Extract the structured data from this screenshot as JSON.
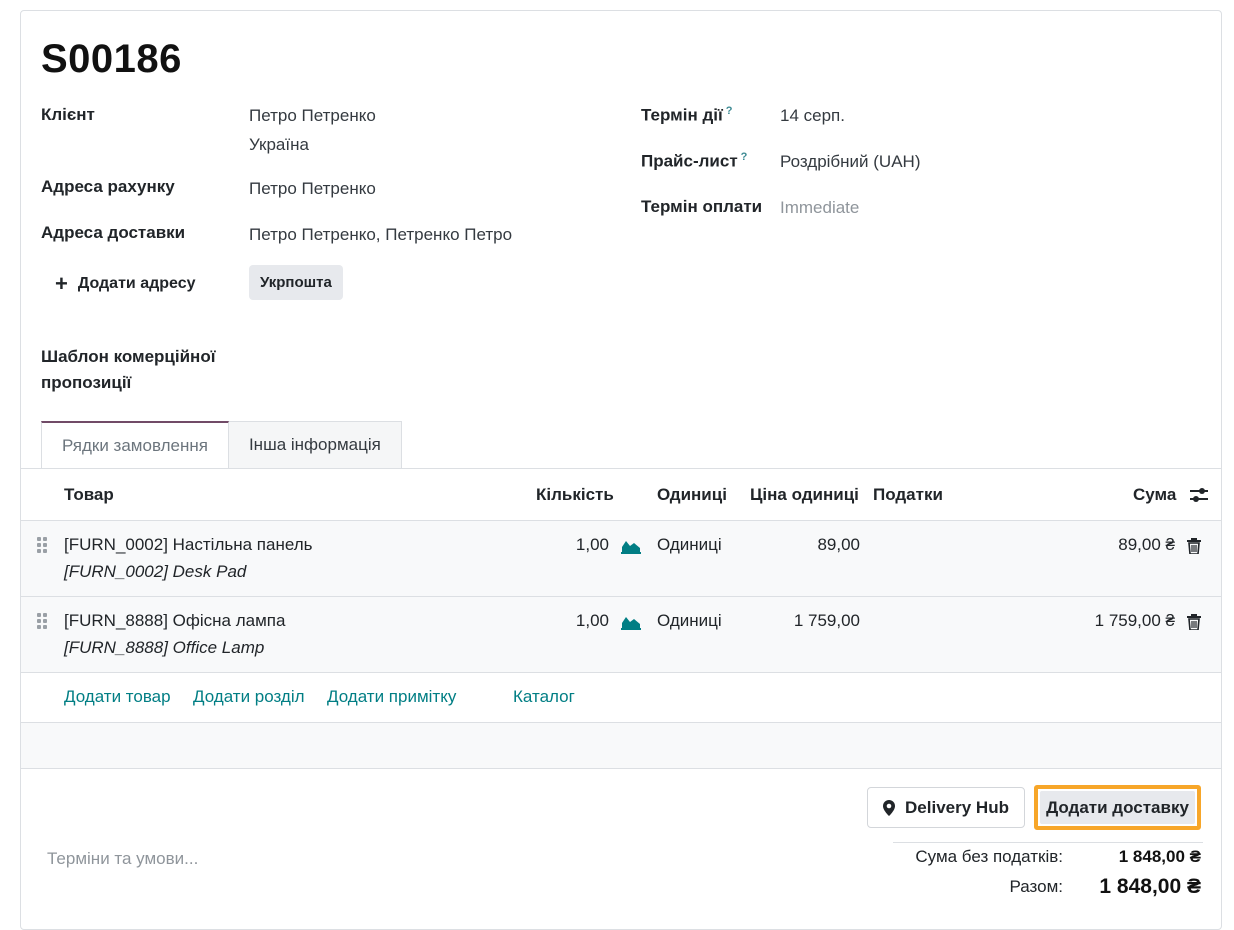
{
  "order": {
    "number": "S00186"
  },
  "customer": {
    "client_label": "Клієнт",
    "client_name": "Петро Петренко",
    "client_country": "Україна",
    "invoice_address_label": "Адреса рахунку",
    "invoice_address": "Петро Петренко",
    "delivery_address_label": "Адреса доставки",
    "delivery_address": "Петро Петренко, Петренко Петро",
    "add_address_label": "Додати адресу",
    "carrier_tag": "Укрпошта",
    "quote_template_label": "Шаблон комерційної пропозиції"
  },
  "right_fields": {
    "validity_label": "Термін дії",
    "validity_value": "14 серп.",
    "pricelist_label": "Прайс-лист",
    "pricelist_value": "Роздрібний (UAH)",
    "payment_terms_label": "Термін оплати",
    "payment_terms_placeholder": "Immediate",
    "help_mark": "?"
  },
  "tabs": [
    {
      "label": "Рядки замовлення",
      "active": true
    },
    {
      "label": "Інша інформація",
      "active": false
    }
  ],
  "table": {
    "headers": {
      "product": "Товар",
      "quantity": "Кількість",
      "uom": "Одиниці",
      "unit_price": "Ціна одиниці",
      "taxes": "Податки",
      "subtotal": "Сума"
    },
    "rows": [
      {
        "product": "[FURN_0002] Настільна панель",
        "description": "[FURN_0002] Desk Pad",
        "quantity": "1,00",
        "uom": "Одиниці",
        "unit_price": "89,00",
        "taxes": "",
        "subtotal": "89,00 ₴"
      },
      {
        "product": "[FURN_8888] Офісна лампа",
        "description": "[FURN_8888] Office Lamp",
        "quantity": "1,00",
        "uom": "Одиниці",
        "unit_price": "1 759,00",
        "taxes": "",
        "subtotal": "1 759,00 ₴"
      }
    ],
    "add_links": {
      "add_product": "Додати товар",
      "add_section": "Додати розділ",
      "add_note": "Додати примітку",
      "catalog": "Каталог"
    }
  },
  "footer": {
    "delivery_hub_label": "Delivery Hub",
    "add_delivery_label": "Додати доставку",
    "terms_placeholder": "Терміни та умови...",
    "untaxed_label": "Сума без податків:",
    "untaxed_value": "1 848,00 ₴",
    "total_label": "Разом:",
    "total_value": "1 848,00 ₴"
  },
  "colors": {
    "accent_link": "#017e84",
    "highlight_border": "#f7a629",
    "active_tab_border": "#714b67"
  },
  "icons": [
    "plus-icon",
    "forecast-chart-icon",
    "trash-icon",
    "drag-handle-icon",
    "optional-columns-icon",
    "map-marker-icon"
  ]
}
